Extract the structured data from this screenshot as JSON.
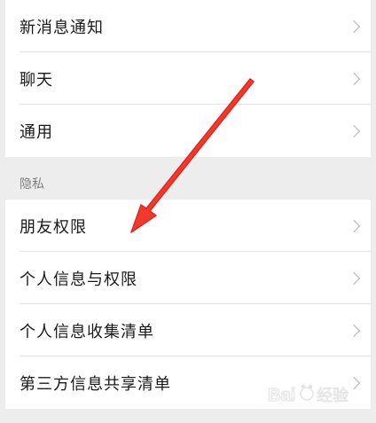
{
  "settings": {
    "group1": [
      {
        "label": "新消息通知"
      },
      {
        "label": "聊天"
      },
      {
        "label": "通用"
      }
    ],
    "privacy_header": "隐私",
    "group2": [
      {
        "label": "朋友权限"
      },
      {
        "label": "个人信息与权限"
      },
      {
        "label": "个人信息收集清单"
      },
      {
        "label": "第三方信息共享清单"
      }
    ]
  },
  "watermark": {
    "text": "Baidu 经验"
  },
  "colors": {
    "arrow": "#f03a2e",
    "background": "#ededed",
    "row_bg": "#ffffff"
  }
}
